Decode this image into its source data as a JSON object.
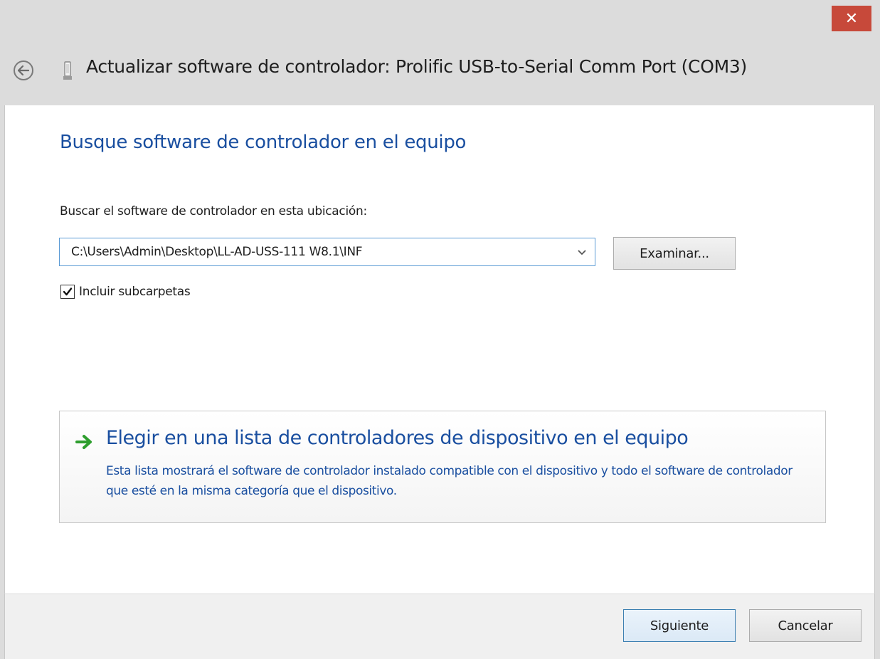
{
  "window": {
    "title": "Actualizar software de controlador: Prolific USB-to-Serial Comm Port (COM3)",
    "close_label": "✕"
  },
  "page": {
    "heading": "Busque software de controlador en el equipo",
    "location_label": "Buscar el software de controlador en esta ubicación:",
    "path_value": "C:\\Users\\Admin\\Desktop\\LL-AD-USS-111 W8.1\\INF",
    "browse_label": "Examinar...",
    "include_subfolders_label": "Incluir subcarpetas",
    "include_subfolders_checked": true
  },
  "choice": {
    "title": "Elegir en una lista de controladores de dispositivo en el equipo",
    "description": "Esta lista mostrará el software de controlador instalado compatible con el dispositivo y todo el software de controlador que esté en la misma categoría que el dispositivo."
  },
  "footer": {
    "next_label": "Siguiente",
    "cancel_label": "Cancelar"
  },
  "icons": {
    "close": "close-icon",
    "back": "back-arrow-icon",
    "device": "usb-device-icon",
    "dropdown": "chevron-down-icon",
    "checkmark": "checkmark-icon",
    "choice_arrow": "green-arrow-icon"
  },
  "colors": {
    "close_button": "#c7493a",
    "link_blue": "#1a4fa0",
    "input_border": "#5b9bd5",
    "choice_arrow": "#2e9e2e"
  }
}
